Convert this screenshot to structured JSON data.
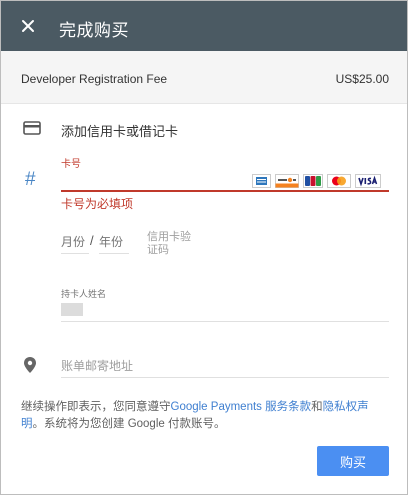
{
  "header": {
    "title": "完成购买",
    "close_icon": "close-icon"
  },
  "fee": {
    "label": "Developer Registration Fee",
    "amount": "US$25.00"
  },
  "add_card": {
    "label": "添加信用卡或借记卡",
    "icon": "credit-card-icon"
  },
  "card_number": {
    "label": "卡号",
    "value": "",
    "error": "卡号为必填项",
    "brands": [
      "AMEX",
      "DISCOVER",
      "JCB",
      "Mastercard",
      "VISA"
    ]
  },
  "expiry": {
    "month_placeholder": "月份",
    "separator": "/",
    "year_placeholder": "年份"
  },
  "cvc": {
    "label": "信用卡验证码"
  },
  "holder": {
    "label": "持卡人姓名"
  },
  "billing": {
    "placeholder": "账单邮寄地址"
  },
  "terms": {
    "prefix": "继续操作即表示，您同意遵守",
    "link1": "Google Payments 服务条款",
    "middle": "和",
    "link2": "隐私权声明",
    "suffix": "。系统将为您创建 Google 付款账号。"
  },
  "buy_button": {
    "label": "购买"
  },
  "colors": {
    "header": "#4b5a63",
    "error": "#c0392b",
    "link": "#3f7fd0",
    "primary_button": "#4b8ff2"
  }
}
